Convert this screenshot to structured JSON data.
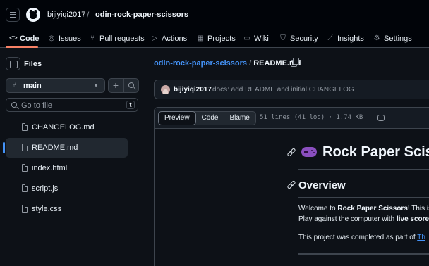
{
  "header": {
    "owner": "bijiyiqi2017",
    "separator": "/",
    "repo": "odin-rock-paper-scissors"
  },
  "tabs": [
    {
      "label": "Code",
      "icon": "code-icon",
      "selected": true
    },
    {
      "label": "Issues",
      "icon": "issue-icon"
    },
    {
      "label": "Pull requests",
      "icon": "pull-request-icon"
    },
    {
      "label": "Actions",
      "icon": "play-icon"
    },
    {
      "label": "Projects",
      "icon": "table-icon"
    },
    {
      "label": "Wiki",
      "icon": "book-icon"
    },
    {
      "label": "Security",
      "icon": "shield-icon"
    },
    {
      "label": "Insights",
      "icon": "graph-icon"
    },
    {
      "label": "Settings",
      "icon": "gear-icon"
    }
  ],
  "sidebar": {
    "title": "Files",
    "branch": "main",
    "search_placeholder": "Go to file",
    "shortcut": "t",
    "files": [
      {
        "name": "CHANGELOG.md"
      },
      {
        "name": "README.md",
        "active": true
      },
      {
        "name": "index.html"
      },
      {
        "name": "script.js"
      },
      {
        "name": "style.css"
      }
    ]
  },
  "main": {
    "path_repo": "odin-rock-paper-scissors",
    "path_sep": "/",
    "path_file": "README.md",
    "commit": {
      "author": "bijiyiqi2017",
      "message": "docs: add README and initial CHANGELOG"
    },
    "viewer": {
      "buttons": [
        "Preview",
        "Code",
        "Blame"
      ],
      "selected": "Preview",
      "meta": "51 lines (41 loc) · 1.74 KB"
    },
    "readme": {
      "h1": "Rock Paper Sciss",
      "h2": "Overview",
      "p1_a": "Welcome to ",
      "p1_b": "Rock Paper Scissors",
      "p1_c": "! This is",
      "p2_a": "Play against the computer with ",
      "p2_b": "live score",
      "p3_a": "This project was completed as part of ",
      "p3_link": "Th"
    }
  },
  "colors": {
    "background": "#0d1117",
    "link": "#4493f8",
    "tab_underline": "#f78166"
  }
}
